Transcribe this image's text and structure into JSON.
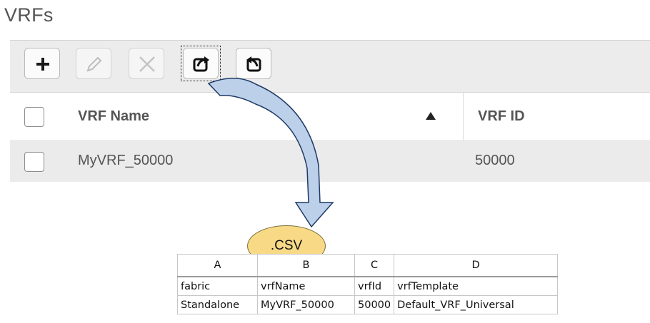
{
  "page": {
    "title": "VRFs"
  },
  "toolbar": {
    "buttons": [
      {
        "name": "add",
        "icon": "plus-icon",
        "enabled": true
      },
      {
        "name": "edit",
        "icon": "pencil-icon",
        "enabled": false
      },
      {
        "name": "delete",
        "icon": "close-icon",
        "enabled": false
      },
      {
        "name": "export",
        "icon": "export-icon",
        "enabled": true,
        "focused": true
      },
      {
        "name": "import",
        "icon": "import-icon",
        "enabled": true
      }
    ]
  },
  "table": {
    "columns": [
      "VRF Name",
      "VRF ID"
    ],
    "sort": {
      "column": "VRF Name",
      "direction": "ascending"
    },
    "rows": [
      {
        "vrf_name": "MyVRF_50000",
        "vrf_id": "50000"
      }
    ]
  },
  "annotation": {
    "badge": ".CSV",
    "arrow_color": "#bcd0ea",
    "badge_color": "#f8da86"
  },
  "spreadsheet": {
    "column_letters": [
      "A",
      "B",
      "C",
      "D"
    ],
    "rows": [
      [
        "fabric",
        "vrfName",
        "vrfId",
        "vrfTemplate"
      ],
      [
        "Standalone",
        "MyVRF_50000",
        "50000",
        "Default_VRF_Universal"
      ]
    ]
  }
}
